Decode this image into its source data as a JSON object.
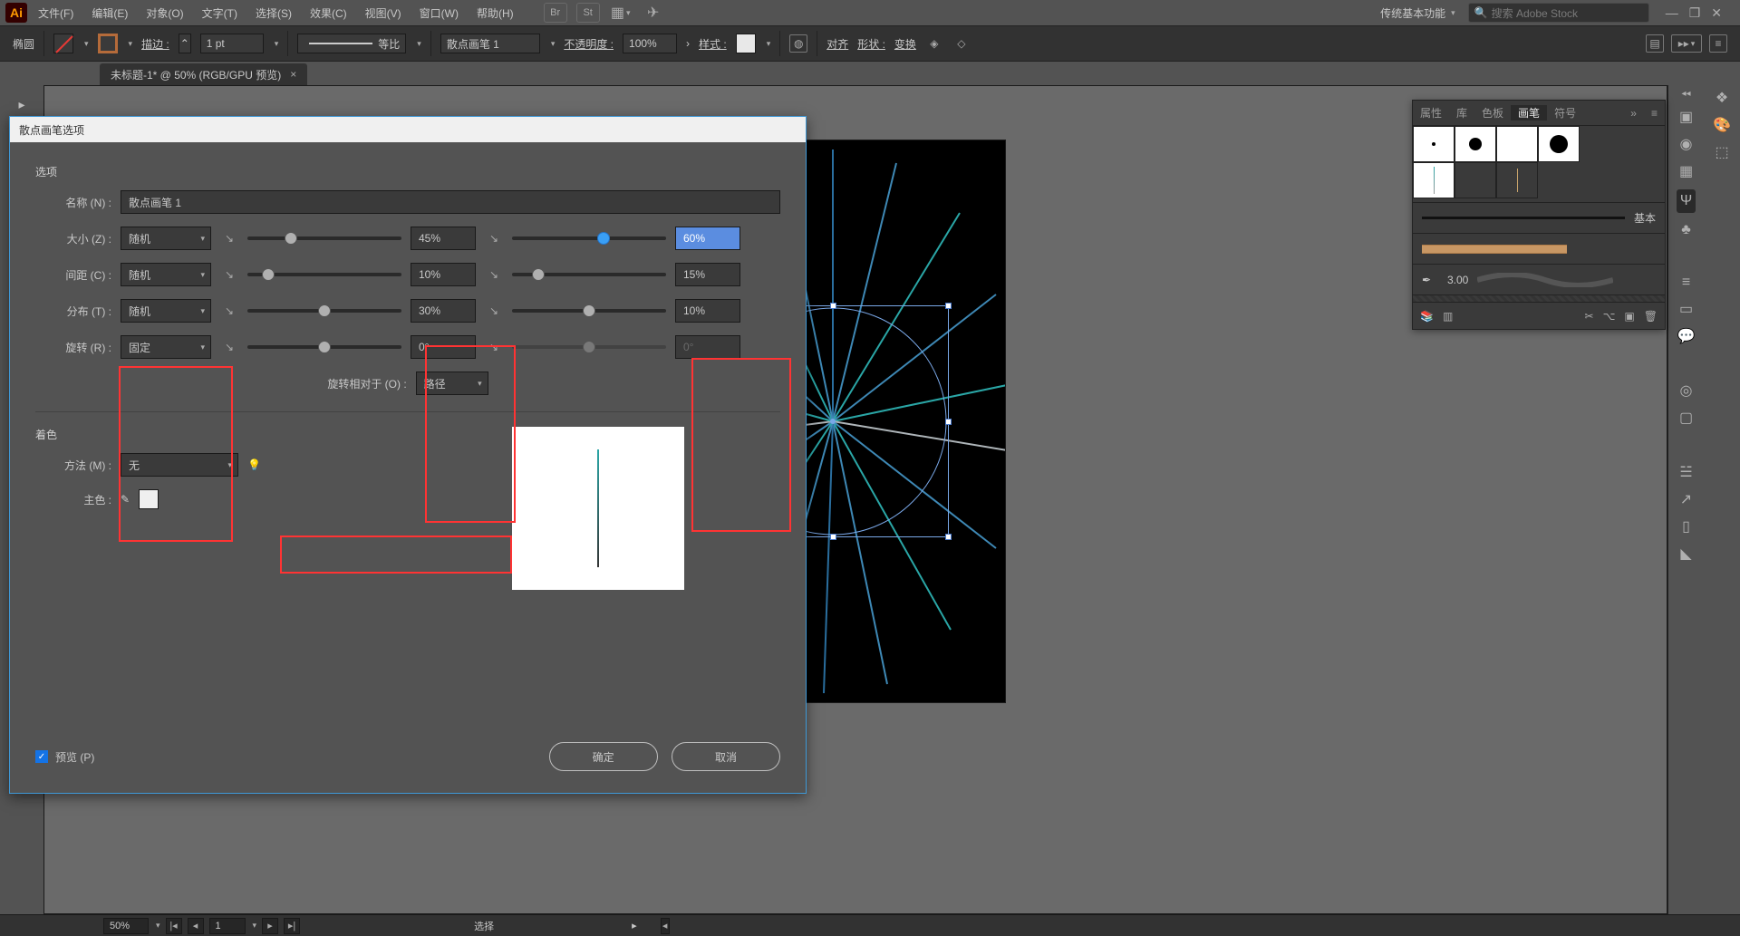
{
  "menubar": {
    "items": [
      "文件(F)",
      "编辑(E)",
      "对象(O)",
      "文字(T)",
      "选择(S)",
      "效果(C)",
      "视图(V)",
      "窗口(W)",
      "帮助(H)"
    ],
    "workspace": "传统基本功能",
    "search_placeholder": "搜索 Adobe Stock"
  },
  "options": {
    "tool": "椭圆",
    "stroke_label": "描边 :",
    "stroke_value": "1 pt",
    "profile": "等比",
    "profile_label": "",
    "brush_label": "散点画笔 1",
    "opacity_label": "不透明度 :",
    "opacity_value": "100%",
    "style_label": "样式 :",
    "align_label": "对齐",
    "shape_label": "形状 :",
    "transform_label": "变换"
  },
  "doc": {
    "tab": "未标题-1* @ 50% (RGB/GPU 预览)"
  },
  "brushes_panel": {
    "tabs": [
      "属性",
      "库",
      "色板",
      "画笔",
      "符号"
    ],
    "active": 3,
    "basic": "基本",
    "cal": "3.00"
  },
  "statusbar": {
    "zoom": "50%",
    "art": "1",
    "status": "选择"
  },
  "dialog": {
    "title": "散点画笔选项",
    "options_label": "选项",
    "name_label": "名称 (N) :",
    "name": "散点画笔 1",
    "rows": [
      {
        "label": "大小 (Z) :",
        "mode": "随机",
        "v1": "45%",
        "v2": "60%",
        "v2_selected": true,
        "t1": 26,
        "t2": 60,
        "blue": true
      },
      {
        "label": "间距 (C) :",
        "mode": "随机",
        "v1": "10%",
        "v2": "15%",
        "t1": 10,
        "t2": 14
      },
      {
        "label": "分布 (T) :",
        "mode": "随机",
        "v1": "30%",
        "v2": "10%",
        "t1": 50,
        "t2": 50
      },
      {
        "label": "旋转 (R) :",
        "mode": "固定",
        "v1": "0°",
        "v2": "0°",
        "v2_disabled": true,
        "t1": 50,
        "t2": 50,
        "s2_disabled": true
      }
    ],
    "rotate_rel_label": "旋转相对于 (O) :",
    "rotate_rel": "路径",
    "color_label": "着色",
    "method_label": "方法 (M) :",
    "method": "无",
    "key_label": "主色 :",
    "preview_label": "预览 (P)",
    "ok": "确定",
    "cancel": "取消"
  }
}
